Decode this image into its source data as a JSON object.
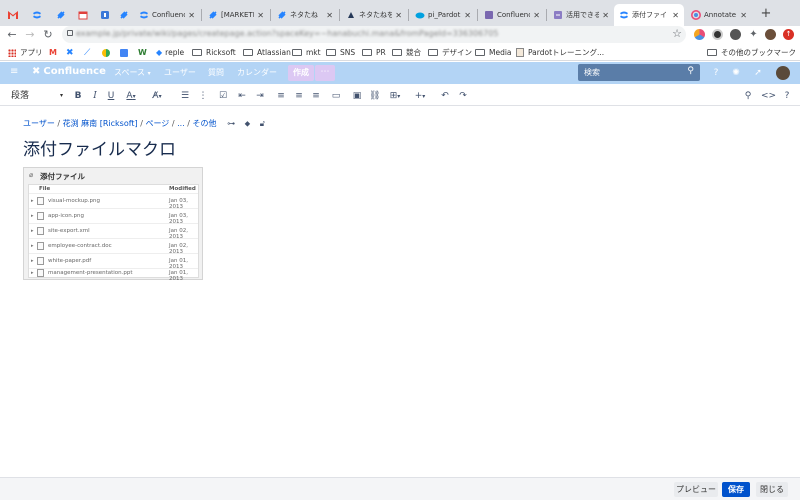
{
  "browser": {
    "tabs": [
      {
        "title": "",
        "active": false
      },
      {
        "title": "",
        "active": false
      },
      {
        "title": "",
        "active": false
      },
      {
        "title": "",
        "active": false
      },
      {
        "title": "",
        "active": false
      },
      {
        "title": "",
        "active": false
      },
      {
        "title": "Confluence",
        "active": false
      },
      {
        "title": "[MARKETI",
        "active": false
      },
      {
        "title": "ネタたね",
        "active": false
      },
      {
        "title": "ネタたねを",
        "active": false
      },
      {
        "title": "pi_Pardot",
        "active": false
      },
      {
        "title": "Confluence",
        "active": false
      },
      {
        "title": "活用できる",
        "active": false
      },
      {
        "title": "添付ファイ",
        "active": true
      },
      {
        "title": "Annotate",
        "active": false
      }
    ],
    "url": "example.jp/private/wiki/pages/createpage.action?spaceKey=~hanabuchi.mana&fromPageId=336306705",
    "bookmarks": [
      {
        "label": "アプリ",
        "type": "apps"
      },
      {
        "label": "",
        "type": "icon"
      },
      {
        "label": "",
        "type": "icon"
      },
      {
        "label": "",
        "type": "icon"
      },
      {
        "label": "",
        "type": "icon"
      },
      {
        "label": "",
        "type": "icon"
      },
      {
        "label": "",
        "type": "icon"
      },
      {
        "label": "reple",
        "type": "link"
      },
      {
        "label": "Ricksoft",
        "type": "folder"
      },
      {
        "label": "Atlassian",
        "type": "folder"
      },
      {
        "label": "mkt",
        "type": "folder"
      },
      {
        "label": "SNS",
        "type": "folder"
      },
      {
        "label": "PR",
        "type": "folder"
      },
      {
        "label": "競合",
        "type": "folder"
      },
      {
        "label": "デザイン",
        "type": "folder"
      },
      {
        "label": "Media",
        "type": "folder"
      },
      {
        "label": "Pardotトレーニング...",
        "type": "link"
      }
    ],
    "other_bookmarks": "その他のブックマーク"
  },
  "confluence": {
    "logo": "Confluence",
    "nav": [
      "スペース",
      "ユーザー",
      "質問",
      "カレンダー"
    ],
    "create": "作成",
    "more": "⋯",
    "search_placeholder": "検索",
    "accent": "#b3d4f5"
  },
  "editor": {
    "paragraph_style": "段落",
    "breadcrumb": [
      "ユーザー",
      "花渕 麻南 [Ricksoft]",
      "ページ",
      "...",
      "その他"
    ],
    "title": "添付ファイルマクロ"
  },
  "attachments": {
    "title": "添付ファイル",
    "col_file": "File",
    "col_modified": "Modified",
    "files": [
      {
        "name": "visual-mockup.png",
        "date": "Jan 03, 2013"
      },
      {
        "name": "app-icon.png",
        "date": "Jan 03, 2013"
      },
      {
        "name": "site-export.xml",
        "date": "Jan 02, 2013"
      },
      {
        "name": "employee-contract.doc",
        "date": "Jan 02, 2013"
      },
      {
        "name": "white-paper.pdf",
        "date": "Jan 01, 2013"
      },
      {
        "name": "management-presentation.ppt",
        "date": "Jan 01, 2013"
      }
    ]
  },
  "footer": {
    "preview": "プレビュー",
    "save": "保存",
    "close": "閉じる"
  }
}
